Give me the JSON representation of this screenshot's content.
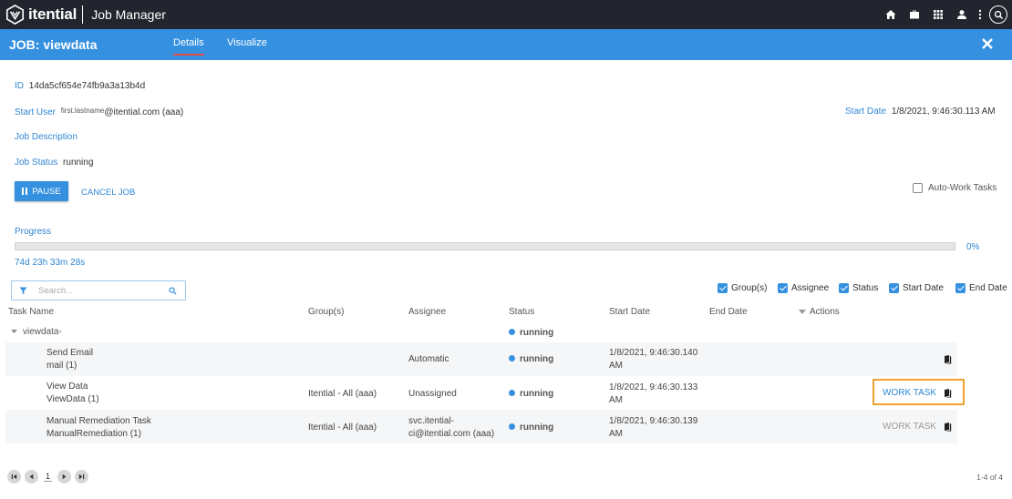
{
  "app": {
    "brand": "itential",
    "title": "Job Manager"
  },
  "topnav": {
    "icons": [
      "home-icon",
      "briefcase-icon",
      "apps-grid-icon",
      "user-icon",
      "more-vertical-icon",
      "search-icon"
    ]
  },
  "job": {
    "title": "JOB: viewdata",
    "tabs": [
      {
        "label": "Details",
        "active": true
      },
      {
        "label": "Visualize",
        "active": false
      }
    ]
  },
  "details": {
    "id_label": "ID",
    "id_value": "14da5cf654e74fb9a3a13b4d",
    "start_user_label": "Start User",
    "start_user_name": "first.lastname",
    "start_user_suffix": "@itential.com (aaa)",
    "start_date_label": "Start Date",
    "start_date_value": "1/8/2021, 9:46:30.113 AM",
    "description_label": "Job Description",
    "status_label": "Job Status",
    "status_value": "running"
  },
  "actions": {
    "pause_label": "PAUSE",
    "cancel_label": "CANCEL JOB",
    "auto_work_label": "Auto-Work Tasks",
    "auto_work_checked": false
  },
  "progress": {
    "label": "Progress",
    "percent": 0,
    "percent_text": "0%",
    "elapsed": "74d 23h 33m 28s"
  },
  "search": {
    "placeholder": "Search..."
  },
  "column_toggles": [
    {
      "label": "Group(s)",
      "checked": true
    },
    {
      "label": "Assignee",
      "checked": true
    },
    {
      "label": "Status",
      "checked": true
    },
    {
      "label": "Start Date",
      "checked": true
    },
    {
      "label": "End Date",
      "checked": true
    }
  ],
  "table": {
    "headers": {
      "task_name": "Task Name",
      "groups": "Group(s)",
      "assignee": "Assignee",
      "status": "Status",
      "start_date": "Start Date",
      "end_date": "End Date",
      "actions": "Actions"
    },
    "group": {
      "name": "viewdata-",
      "status": "running"
    },
    "rows": [
      {
        "name": "Send Email",
        "sub": "mail (1)",
        "groups": "",
        "assignee": "Automatic",
        "status": "running",
        "start_date_1": "1/8/2021, 9:46:30.140",
        "start_date_2": "AM",
        "end_date": "",
        "work_task": ""
      },
      {
        "name": "View Data",
        "sub": "ViewData (1)",
        "groups": "Itential - All (aaa)",
        "assignee": "Unassigned",
        "status": "running",
        "start_date_1": "1/8/2021, 9:46:30.133",
        "start_date_2": "AM",
        "end_date": "",
        "work_task": "WORK TASK"
      },
      {
        "name": "Manual Remediation Task",
        "sub": "ManualRemediation (1)",
        "groups": "Itential - All (aaa)",
        "assignee_1": "svc.itential-",
        "assignee_2": "ci@itential.com (aaa)",
        "status": "running",
        "start_date_1": "1/8/2021, 9:46:30.139",
        "start_date_2": "AM",
        "end_date": "",
        "work_task": "WORK TASK"
      }
    ]
  },
  "pagination": {
    "page": "1",
    "count_text": "1-4 of 4"
  },
  "colors": {
    "topbar": "#22252d",
    "accent": "#3591e0",
    "label_blue": "#2f86d2",
    "highlight": "#f0a030"
  }
}
